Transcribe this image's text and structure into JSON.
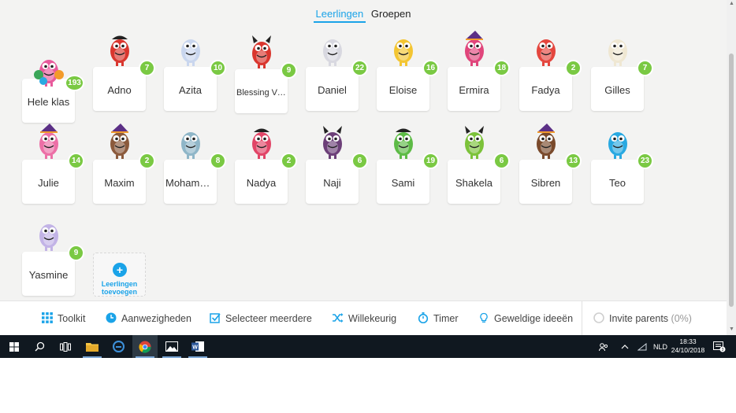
{
  "tabs": [
    {
      "label": "Leerlingen",
      "active": true
    },
    {
      "label": "Groepen",
      "active": false
    }
  ],
  "students": [
    {
      "name": "Hele klas",
      "points": "193",
      "icon": "group-monsters-icon",
      "color": "#e85a9c"
    },
    {
      "name": "Adno",
      "points": "7",
      "icon": "pirate-monster-icon",
      "color": "#d9362e"
    },
    {
      "name": "Azita",
      "points": "10",
      "icon": "ghost-monster-icon",
      "color": "#c9d6ee"
    },
    {
      "name": "Blessing Vi...",
      "points": "9",
      "icon": "vampire-monster-icon",
      "color": "#d9362e"
    },
    {
      "name": "Daniel",
      "points": "22",
      "icon": "eyeball-monster-icon",
      "color": "#d8d8e0"
    },
    {
      "name": "Eloise",
      "points": "16",
      "icon": "yellow-monster-icon",
      "color": "#f3c532"
    },
    {
      "name": "Ermira",
      "points": "18",
      "icon": "witch-monster-icon",
      "color": "#e0457b"
    },
    {
      "name": "Fadya",
      "points": "2",
      "icon": "red-monster-icon",
      "color": "#e4463e"
    },
    {
      "name": "Gilles",
      "points": "7",
      "icon": "mummy-monster-icon",
      "color": "#efe7d2"
    },
    {
      "name": "Julie",
      "points": "14",
      "icon": "witch-monster-icon",
      "color": "#ec6fa6"
    },
    {
      "name": "Maxim",
      "points": "2",
      "icon": "witch-hat-monster-icon",
      "color": "#8b5a3c"
    },
    {
      "name": "Mohammed",
      "points": "8",
      "icon": "robot-monster-icon",
      "color": "#8fb6c8"
    },
    {
      "name": "Nadya",
      "points": "2",
      "icon": "pirate-monster-icon",
      "color": "#e14567"
    },
    {
      "name": "Naji",
      "points": "6",
      "icon": "bat-monster-icon",
      "color": "#6c3f78"
    },
    {
      "name": "Sami",
      "points": "19",
      "icon": "pirate-monster-icon",
      "color": "#5dbb46"
    },
    {
      "name": "Shakela",
      "points": "6",
      "icon": "devil-monster-icon",
      "color": "#7cc23a"
    },
    {
      "name": "Sibren",
      "points": "13",
      "icon": "witch-monster-icon",
      "color": "#7a4a2c"
    },
    {
      "name": "Teo",
      "points": "23",
      "icon": "blue-monster-icon",
      "color": "#29a9e1"
    },
    {
      "name": "Yasmine",
      "points": "9",
      "icon": "ghost-monster-icon",
      "color": "#c2b3e6"
    }
  ],
  "add_student": {
    "line1": "Leerlingen",
    "line2": "toevoegen"
  },
  "toolbar": {
    "toolkit": "Toolkit",
    "attendance": "Aanwezigheden",
    "select_multiple": "Selecteer meerdere",
    "random": "Willekeurig",
    "timer": "Timer",
    "great_ideas": "Geweldige ideeën",
    "invite_parents": "Invite parents",
    "invite_parents_pct": "(0%)"
  },
  "taskbar": {
    "language": "NLD",
    "time": "18:33",
    "date": "24/10/2018",
    "notification_count": "3"
  },
  "colors": {
    "accent": "#1aa3e8",
    "badge": "#7ac943",
    "taskbar": "#101820"
  }
}
